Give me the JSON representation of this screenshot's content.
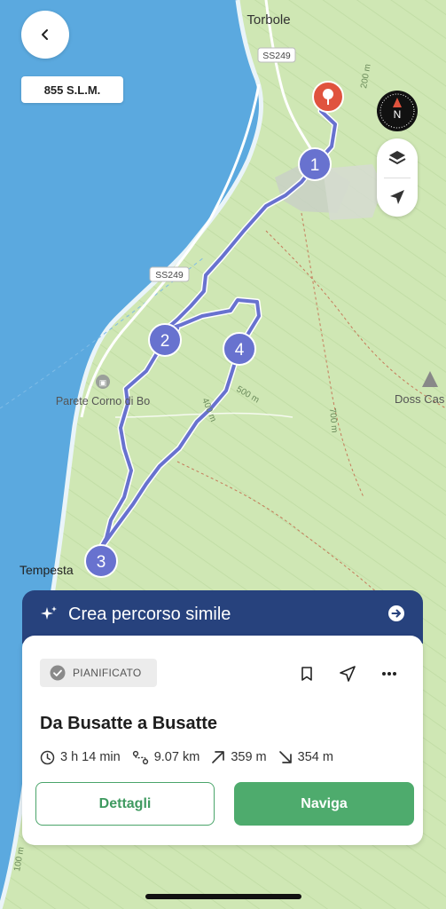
{
  "map": {
    "place_labels": [
      "Torbole",
      "Parete Corno di Bo",
      "Doss Cas",
      "Tempesta"
    ],
    "road_labels": [
      "SS249",
      "SS249"
    ],
    "contour_labels": [
      "200 m",
      "400 m",
      "500 m",
      "700 m",
      "100 m"
    ],
    "waypoints": [
      "1",
      "2",
      "3",
      "4"
    ],
    "colors": {
      "water": "#5ba9df",
      "land": "#cfe7b4",
      "route": "#6872cf",
      "start_pin": "#e0533e"
    }
  },
  "header": {
    "back_icon": "chevron-left-icon",
    "altitude": "855 S.L.M."
  },
  "controls": {
    "compass_letter": "N",
    "layers_icon": "layers-icon",
    "locate_icon": "location-arrow-icon"
  },
  "banner": {
    "label": "Crea percorso simile",
    "colors": {
      "background": "#27427d"
    }
  },
  "route_card": {
    "status": "PIANIFICATO",
    "title": "Da Busatte a Busatte",
    "stats": {
      "duration": "3 h 14 min",
      "distance": "9.07 km",
      "ascent": "359 m",
      "descent": "354 m"
    },
    "details_label": "Dettagli",
    "navigate_label": "Naviga",
    "colors": {
      "primary": "#4eab6d"
    }
  }
}
